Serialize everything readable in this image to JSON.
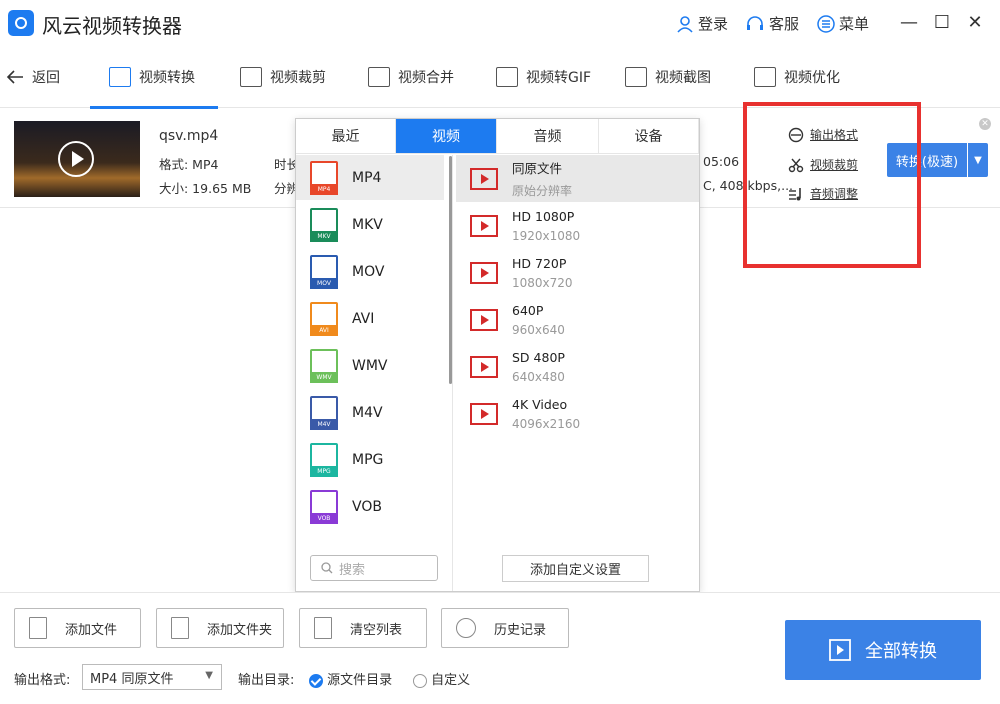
{
  "app": {
    "title": "风云视频转换器"
  },
  "titlebar": {
    "login": "登录",
    "service": "客服",
    "menu": "菜单"
  },
  "nav": {
    "back": "返回",
    "tabs": [
      {
        "label": "视频转换",
        "active": true
      },
      {
        "label": "视频裁剪"
      },
      {
        "label": "视频合并"
      },
      {
        "label": "视频转GIF"
      },
      {
        "label": "视频截图"
      },
      {
        "label": "视频优化"
      }
    ]
  },
  "file": {
    "name": "qsv.mp4",
    "format": "格式: MP4",
    "size": "大小: 19.65 MB",
    "duration_partial": "时长",
    "resolution_partial": "分辨",
    "duration_tail": "05:06",
    "codec_tail": "C, 408 kbps,..."
  },
  "actions": {
    "output_format": "输出格式",
    "video_crop": "视频裁剪",
    "audio_adjust": "音频调整",
    "convert": "转换(极速)"
  },
  "popup": {
    "tabs": [
      {
        "label": "最近"
      },
      {
        "label": "视频",
        "active": true
      },
      {
        "label": "音频"
      },
      {
        "label": "设备"
      }
    ],
    "formats": [
      {
        "label": "MP4",
        "tag": "MP4",
        "color": "#e8472a",
        "selected": true
      },
      {
        "label": "MKV",
        "tag": "MKV",
        "color": "#1a8c5a"
      },
      {
        "label": "MOV",
        "tag": "MOV",
        "color": "#2a5bb0"
      },
      {
        "label": "AVI",
        "tag": "AVI",
        "color": "#f08a1c"
      },
      {
        "label": "WMV",
        "tag": "WMV",
        "color": "#6cc05a"
      },
      {
        "label": "M4V",
        "tag": "M4V",
        "color": "#3a5aa8"
      },
      {
        "label": "MPG",
        "tag": "MPG",
        "color": "#1cb6a0"
      },
      {
        "label": "VOB",
        "tag": "VOB",
        "color": "#8a3ad6"
      }
    ],
    "resolutions": [
      {
        "name": "同原文件",
        "sub": "原始分辨率",
        "selected": true
      },
      {
        "name": "HD 1080P",
        "sub": "1920x1080"
      },
      {
        "name": "HD 720P",
        "sub": "1080x720"
      },
      {
        "name": "640P",
        "sub": "960x640"
      },
      {
        "name": "SD 480P",
        "sub": "640x480"
      },
      {
        "name": "4K Video",
        "sub": "4096x2160"
      }
    ],
    "search_placeholder": "搜索",
    "custom_button": "添加自定义设置"
  },
  "bottom": {
    "add_file": "添加文件",
    "add_folder": "添加文件夹",
    "clear_list": "清空列表",
    "history": "历史记录",
    "output_format_label": "输出格式:",
    "output_format_value": "MP4 同原文件",
    "output_dir_label": "输出目录:",
    "dir_source": "源文件目录",
    "dir_custom": "自定义",
    "convert_all": "全部转换"
  },
  "colors": {
    "accent": "#1d7bf0",
    "button": "#3b82e6",
    "highlight": "#e8312f"
  }
}
